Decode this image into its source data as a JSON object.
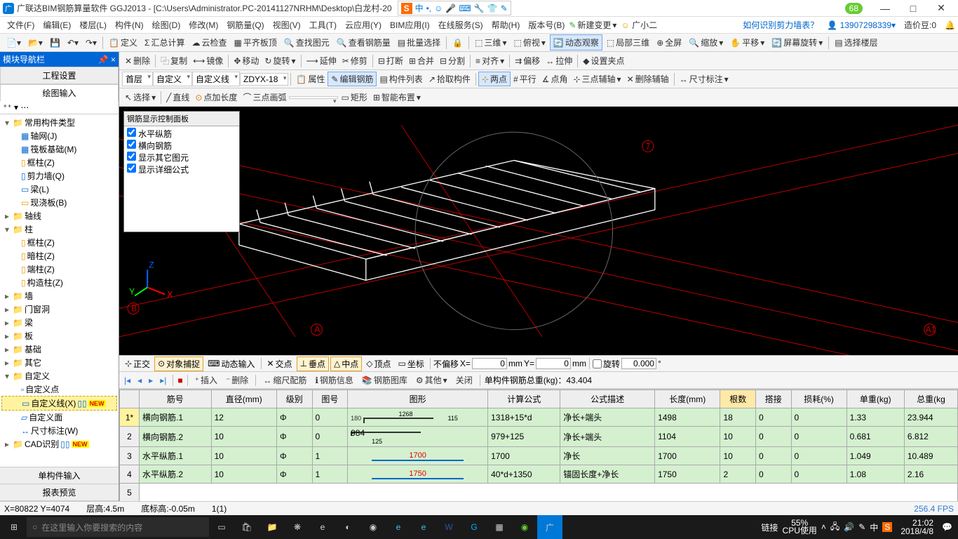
{
  "titlebar": {
    "app_name": "广联达BIM钢筋算量软件 GGJ2013 - [C:\\Users\\Administrator.PC-20141127NRHM\\Desktop\\白龙村-20",
    "ime_mode": "中",
    "badge": "68"
  },
  "menu": {
    "items": [
      "文件(F)",
      "编辑(E)",
      "楼层(L)",
      "构件(N)",
      "绘图(D)",
      "修改(M)",
      "钢筋量(Q)",
      "视图(V)",
      "工具(T)",
      "云应用(Y)",
      "BIM应用(I)",
      "在线服务(S)",
      "帮助(H)",
      "版本号(B)"
    ],
    "new_change": "新建变更",
    "customer": "广小二",
    "faq_link": "如何识别剪力墙表？",
    "user": "13907298339",
    "coin_label": "造价豆:0"
  },
  "toolbar1": {
    "define": "定义",
    "sumcalc": "汇总计算",
    "cloudcheck": "云检查",
    "flatroof": "平齐板顶",
    "findgraph": "查找图元",
    "viewrebar": "查看钢筋量",
    "batchsel": "批量选择",
    "threed": "三维",
    "topview": "俯视",
    "dynview": "动态观察",
    "local3d": "局部三维",
    "fullscreen": "全屏",
    "zoom": "缩放",
    "pan": "平移",
    "screenrot": "屏幕旋转",
    "selfloor": "选择楼层"
  },
  "toolbar2": {
    "del": "删除",
    "copy": "复制",
    "mirror": "镜像",
    "move": "移动",
    "rotate": "旋转",
    "extend": "延伸",
    "trim": "修剪",
    "break": "打断",
    "merge": "合并",
    "split": "分割",
    "align": "对齐",
    "offset": "偏移",
    "stretch": "拉伸",
    "setgrip": "设置夹点"
  },
  "toolbar3": {
    "floor": "首层",
    "custom": "自定义",
    "customline": "自定义线",
    "code": "ZDYX-18",
    "props": "属性",
    "editrebar": "编辑钢筋",
    "complist": "构件列表",
    "pick": "拾取构件",
    "twopt": "两点",
    "parallel": "平行",
    "ptangle": "点角",
    "threeaux": "三点辅轴",
    "delaux": "删除辅轴",
    "dimlabel": "尺寸标注"
  },
  "toolbar4": {
    "select": "选择",
    "line": "直线",
    "ptlen": "点加长度",
    "threearc": "三点画弧",
    "rect": "矩形",
    "smart": "智能布置"
  },
  "nav": {
    "title": "模块导航栏",
    "tab1": "工程设置",
    "tab2": "绘图输入",
    "tree": {
      "group1": "常用构件类型",
      "axisnet": "轴网(J)",
      "raft": "筏板基础(M)",
      "framecol": "框柱(Z)",
      "shearwall": "剪力墙(Q)",
      "beam": "梁(L)",
      "slab": "现浇板(B)",
      "axis": "轴线",
      "col": "柱",
      "col1": "框柱(Z)",
      "col2": "暗柱(Z)",
      "col3": "端柱(Z)",
      "col4": "构造柱(Z)",
      "wall": "墙",
      "door": "门窗洞",
      "beam2": "梁",
      "slab2": "板",
      "found": "基础",
      "other": "其它",
      "custom": "自定义",
      "cpt": "自定义点",
      "cline": "自定义线(X)",
      "cface": "自定义面",
      "cdim": "尺寸标注(W)",
      "cad": "CAD识别"
    },
    "bottom1": "单构件输入",
    "bottom2": "报表预览"
  },
  "floatpanel": {
    "title": "钢筋显示控制面板",
    "c1": "水平纵筋",
    "c2": "横向钢筋",
    "c3": "显示其它图元",
    "c4": "显示详细公式"
  },
  "snapbar": {
    "ortho": "正交",
    "osnap": "对象捕捉",
    "dyninput": "动态输入",
    "inter": "交点",
    "perp": "垂点",
    "mid": "中点",
    "end": "顶点",
    "coord": "坐标",
    "noshift": "不偏移",
    "xlabel": "X=",
    "xval": "0",
    "xunit": "mm",
    "ylabel": "Y=",
    "yval": "0",
    "yunit": "mm",
    "rotate": "旋转",
    "rotval": "0.000"
  },
  "rbbar": {
    "insert": "插入",
    "delete": "删除",
    "scale": "缩尺配筋",
    "info": "钢筋信息",
    "lib": "钢筋图库",
    "other": "其他",
    "close": "关闭",
    "weight": "单构件钢筋总重(kg)：43.404"
  },
  "table": {
    "headers": [
      "",
      "筋号",
      "直径(mm)",
      "级别",
      "图号",
      "图形",
      "计算公式",
      "公式描述",
      "长度(mm)",
      "根数",
      "搭接",
      "损耗(%)",
      "单重(kg)",
      "总重(kg"
    ],
    "rows": [
      {
        "n": "1*",
        "name": "横向钢筋.1",
        "dia": "12",
        "lvl": "Φ",
        "fig": "0",
        "shape": "1268",
        "shape2": "115",
        "shape3": "180",
        "formula": "1318+15*d",
        "desc": "净长+端头",
        "len": "1498",
        "cnt": "18",
        "lap": "0",
        "loss": "0",
        "uw": "1.33",
        "tw": "23.944"
      },
      {
        "n": "2",
        "name": "横向钢筋.2",
        "dia": "10",
        "lvl": "Φ",
        "fig": "0",
        "shape": "984",
        "shape2": "125",
        "formula": "979+125",
        "desc": "净长+端头",
        "len": "1104",
        "cnt": "10",
        "lap": "0",
        "loss": "0",
        "uw": "0.681",
        "tw": "6.812"
      },
      {
        "n": "3",
        "name": "水平纵筋.1",
        "dia": "10",
        "lvl": "Φ",
        "fig": "1",
        "shape": "1700",
        "formula": "1700",
        "desc": "净长",
        "len": "1700",
        "cnt": "10",
        "lap": "0",
        "loss": "0",
        "uw": "1.049",
        "tw": "10.489"
      },
      {
        "n": "4",
        "name": "水平纵筋.2",
        "dia": "10",
        "lvl": "Φ",
        "fig": "1",
        "shape": "1750",
        "formula": "40*d+1350",
        "desc": "锚固长度+净长",
        "len": "1750",
        "cnt": "2",
        "lap": "0",
        "loss": "0",
        "uw": "1.08",
        "tw": "2.16"
      },
      {
        "n": "5",
        "name": "",
        "dia": "",
        "lvl": "",
        "fig": "",
        "shape": "",
        "formula": "",
        "desc": "",
        "len": "",
        "cnt": "",
        "lap": "",
        "loss": "",
        "uw": "",
        "tw": ""
      }
    ]
  },
  "status": {
    "coord": "X=80822 Y=4074",
    "floor": "层高:4.5m",
    "bottom": "底标高:-0.05m",
    "sel": "1(1)",
    "fps": "256.4 FPS"
  },
  "taskbar": {
    "search_ph": "在这里输入你要搜索的内容",
    "link": "链接",
    "perf1": "55%",
    "perf2": "CPU使用",
    "time": "21:02",
    "date": "2018/4/8",
    "ime": "中"
  }
}
